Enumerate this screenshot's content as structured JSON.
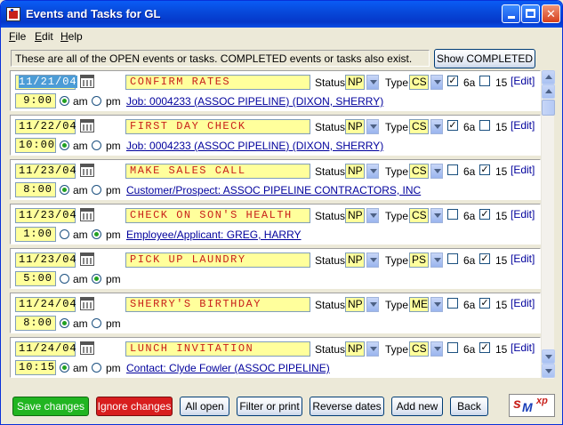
{
  "window": {
    "title": "Events and Tasks for GL"
  },
  "menu": [
    {
      "mnemonic": "F",
      "rest": "ile"
    },
    {
      "mnemonic": "E",
      "rest": "dit"
    },
    {
      "mnemonic": "H",
      "rest": "elp"
    }
  ],
  "info_text": "These are all of the OPEN events or tasks.  COMPLETED events or tasks also exist.",
  "show_completed_label": "Show COMPLETED",
  "labels": {
    "status": "Status",
    "type": "Type",
    "am": "am",
    "pm": "pm",
    "six_a": "6a",
    "fifteen": "15",
    "edit": "[Edit]"
  },
  "rows": [
    {
      "date": "11/21/04",
      "time": "9:00",
      "ampm": "am",
      "subject": "CONFIRM RATES",
      "status": "NP",
      "type": "CS",
      "c6a": true,
      "c15": false,
      "link": "Job: 0004233 (ASSOC PIPELINE) (DIXON, SHERRY)"
    },
    {
      "date": "11/22/04",
      "time": "10:00",
      "ampm": "am",
      "subject": "FIRST DAY CHECK",
      "status": "NP",
      "type": "CS",
      "c6a": true,
      "c15": false,
      "link": "Job: 0004233 (ASSOC PIPELINE) (DIXON, SHERRY)"
    },
    {
      "date": "11/23/04",
      "time": "8:00",
      "ampm": "am",
      "subject": "MAKE SALES CALL",
      "status": "NP",
      "type": "CS",
      "c6a": false,
      "c15": true,
      "link": "Customer/Prospect: ASSOC PIPELINE CONTRACTORS, INC"
    },
    {
      "date": "11/23/04",
      "time": "1:00",
      "ampm": "pm",
      "subject": "CHECK ON SON'S HEALTH",
      "status": "NP",
      "type": "CS",
      "c6a": false,
      "c15": true,
      "link": "Employee/Applicant: GREG, HARRY"
    },
    {
      "date": "11/23/04",
      "time": "5:00",
      "ampm": "pm",
      "subject": "PICK UP LAUNDRY",
      "status": "NP",
      "type": "PS",
      "c6a": false,
      "c15": true,
      "link": ""
    },
    {
      "date": "11/24/04",
      "time": "8:00",
      "ampm": "am",
      "subject": "SHERRY'S BIRTHDAY",
      "status": "NP",
      "type": "ME",
      "c6a": false,
      "c15": true,
      "link": ""
    },
    {
      "date": "11/24/04",
      "time": "10:15",
      "ampm": "am",
      "subject": "LUNCH INVITATION",
      "status": "NP",
      "type": "CS",
      "c6a": false,
      "c15": true,
      "link": "Contact: Clyde Fowler (ASSOC PIPELINE)"
    }
  ],
  "buttons": {
    "save": "Save changes",
    "ignore": "Ignore changes",
    "all_open": "All open",
    "filter": "Filter or print",
    "reverse": "Reverse dates",
    "add_new": "Add new",
    "back": "Back"
  },
  "colors": {
    "save_bg": "#21b521",
    "ignore_bg": "#d81e1e",
    "field_bg": "#ffff9c",
    "subject_text": "#c8201a",
    "link": "#00009c"
  },
  "logo": {
    "s": "s",
    "m": "M",
    "xp": "xp"
  }
}
